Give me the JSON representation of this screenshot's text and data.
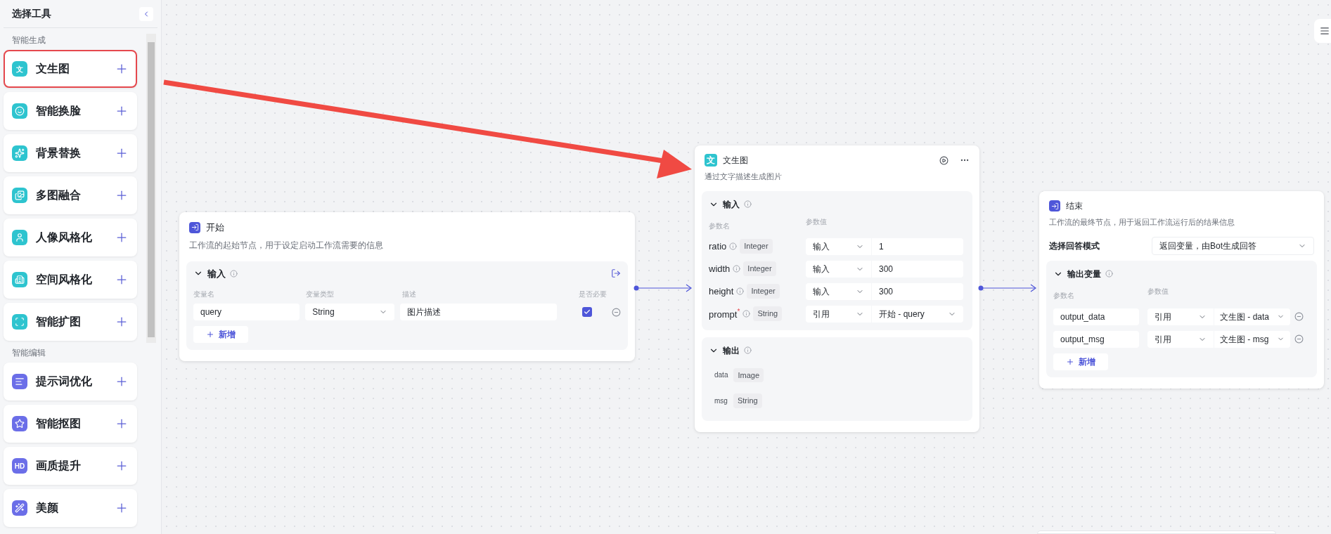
{
  "sidebar": {
    "title": "选择工具",
    "sections": [
      {
        "label": "智能生成",
        "color": "#2ec4cf",
        "items": [
          {
            "label": "文生图",
            "badge": "文",
            "selected": true
          },
          {
            "label": "智能换脸",
            "selected": false
          },
          {
            "label": "背景替换",
            "selected": false
          },
          {
            "label": "多图融合",
            "selected": false
          },
          {
            "label": "人像风格化",
            "selected": false
          },
          {
            "label": "空间风格化",
            "selected": false
          },
          {
            "label": "智能扩图",
            "selected": false
          }
        ]
      },
      {
        "label": "智能编辑",
        "color": "#6b6ee8",
        "items": [
          {
            "label": "提示词优化",
            "selected": false
          },
          {
            "label": "智能抠图",
            "selected": false
          },
          {
            "label": "画质提升",
            "badge": "HD",
            "selected": false
          },
          {
            "label": "美颜",
            "selected": false
          }
        ]
      }
    ]
  },
  "start_node": {
    "title": "开始",
    "description": "工作流的起始节点，用于设定启动工作流需要的信息",
    "input": {
      "title": "输入",
      "expanded": true,
      "columns": [
        "变量名",
        "变量类型",
        "描述",
        "是否必要"
      ],
      "rows": [
        {
          "name": "query",
          "type": "String",
          "description": "图片描述",
          "required": true
        }
      ],
      "add_button": "新增"
    }
  },
  "tool_node": {
    "badge": "文",
    "title": "文生图",
    "description": "通过文字描述生成图片",
    "input": {
      "title": "输入",
      "expanded": true,
      "columns": [
        "参数名",
        "参数值"
      ],
      "required_mark": "*",
      "params": [
        {
          "name": "ratio",
          "required": false,
          "type": "Integer",
          "source": "输入",
          "kind": "text",
          "value": "1"
        },
        {
          "name": "width",
          "required": false,
          "type": "Integer",
          "source": "输入",
          "kind": "text",
          "value": "300"
        },
        {
          "name": "height",
          "required": false,
          "type": "Integer",
          "source": "输入",
          "kind": "text",
          "value": "300"
        },
        {
          "name": "prompt",
          "required": true,
          "type": "String",
          "source": "引用",
          "kind": "select",
          "value": "开始 - query"
        }
      ]
    },
    "output": {
      "title": "输出",
      "expanded": true,
      "fields": [
        {
          "name": "data",
          "type": "Image"
        },
        {
          "name": "msg",
          "type": "String"
        }
      ]
    }
  },
  "end_node": {
    "title": "结束",
    "description": "工作流的最终节点，用于返回工作流运行后的结果信息",
    "mode_label": "选择回答模式",
    "mode_value": "返回变量，由Bot生成回答",
    "output": {
      "title": "输出变量",
      "expanded": true,
      "columns": [
        "参数名",
        "参数值"
      ],
      "rows": [
        {
          "name": "output_data",
          "source": "引用",
          "value": "文生图 - data"
        },
        {
          "name": "output_msg",
          "source": "引用",
          "value": "文生图 - msg"
        }
      ],
      "add_button": "新增"
    }
  }
}
